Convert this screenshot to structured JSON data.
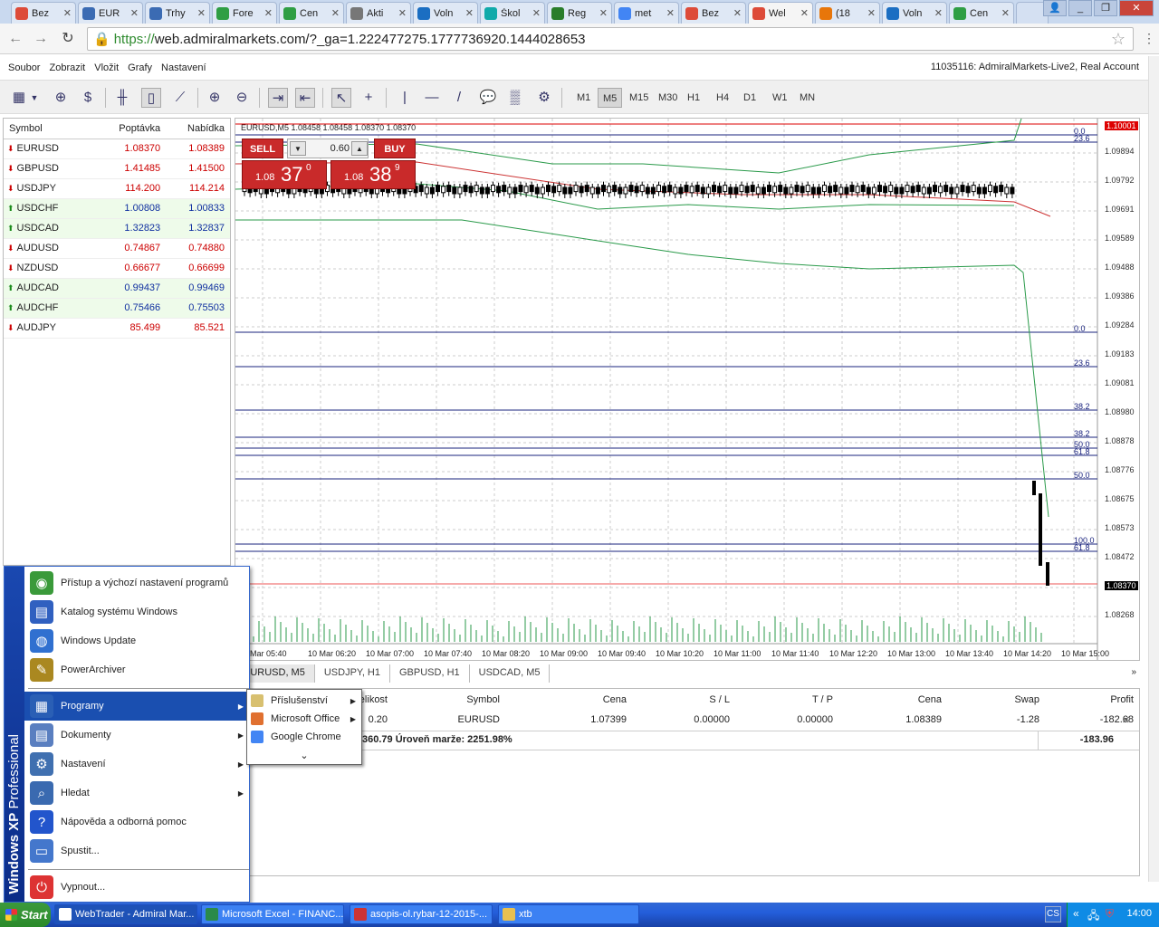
{
  "browser": {
    "tabs": [
      {
        "title": "Bez",
        "icon": "chrome-icon",
        "color": "#dd4b39"
      },
      {
        "title": "EUR",
        "icon": "fx-icon",
        "color": "#3b6bb3"
      },
      {
        "title": "Trhy",
        "icon": "fx-icon",
        "color": "#3b6bb3"
      },
      {
        "title": "Fore",
        "icon": "money-icon",
        "color": "#2f9e44"
      },
      {
        "title": "Cen",
        "icon": "chrome-icon",
        "color": "#2f9e44"
      },
      {
        "title": "Akti",
        "icon": "document-icon",
        "color": "#777777"
      },
      {
        "title": "Voln",
        "icon": "v-icon",
        "color": "#1b6ec2"
      },
      {
        "title": "Škol",
        "icon": "globe-icon",
        "color": "#1aa"
      },
      {
        "title": "Reg",
        "icon": "clover-icon",
        "color": "#2a7d2a"
      },
      {
        "title": "met",
        "icon": "google-icon",
        "color": "#4285f4"
      },
      {
        "title": "Bez",
        "icon": "chrome-icon",
        "color": "#dd4b39"
      },
      {
        "title": "Wel",
        "icon": "chrome-icon",
        "color": "#dd4b39",
        "active": true
      },
      {
        "title": "(18",
        "icon": "euro-icon",
        "color": "#e8760a"
      },
      {
        "title": "Voln",
        "icon": "v-icon",
        "color": "#1b6ec2"
      },
      {
        "title": "Cen",
        "icon": "chrome-icon",
        "color": "#2f9e44"
      }
    ],
    "url_scheme": "https://",
    "url_rest": "web.admiralmarkets.com/?_ga=1.222477275.1777736920.1444028653"
  },
  "app": {
    "menu": [
      "Soubor",
      "Zobrazit",
      "Vložit",
      "Grafy",
      "Nastavení"
    ],
    "account": "11035116: AdmiralMarkets-Live2, Real Account",
    "timeframes": [
      "M1",
      "M5",
      "M15",
      "M30",
      "H1",
      "H4",
      "D1",
      "W1",
      "MN"
    ],
    "active_timeframe": "M5"
  },
  "watchlist": {
    "headers": {
      "symbol": "Symbol",
      "bid": "Poptávka",
      "ask": "Nabídka"
    },
    "rows": [
      {
        "symbol": "EURUSD",
        "bid": "1.08370",
        "ask": "1.08389",
        "dir": "down"
      },
      {
        "symbol": "GBPUSD",
        "bid": "1.41485",
        "ask": "1.41500",
        "dir": "down"
      },
      {
        "symbol": "USDJPY",
        "bid": "114.200",
        "ask": "114.214",
        "dir": "down"
      },
      {
        "symbol": "USDCHF",
        "bid": "1.00808",
        "ask": "1.00833",
        "dir": "up"
      },
      {
        "symbol": "USDCAD",
        "bid": "1.32823",
        "ask": "1.32837",
        "dir": "up"
      },
      {
        "symbol": "AUDUSD",
        "bid": "0.74867",
        "ask": "0.74880",
        "dir": "down"
      },
      {
        "symbol": "NZDUSD",
        "bid": "0.66677",
        "ask": "0.66699",
        "dir": "down"
      },
      {
        "symbol": "AUDCAD",
        "bid": "0.99437",
        "ask": "0.99469",
        "dir": "up"
      },
      {
        "symbol": "AUDCHF",
        "bid": "0.75466",
        "ask": "0.75503",
        "dir": "up"
      },
      {
        "symbol": "AUDJPY",
        "bid": "85.499",
        "ask": "85.521",
        "dir": "down"
      }
    ]
  },
  "chart": {
    "header": "EURUSD,M5  1.08458 1.08458 1.08370 1.08370",
    "sell_label": "SELL",
    "buy_label": "BUY",
    "lot": "0.60",
    "sell_price": {
      "prefix": "1.08",
      "big": "37",
      "sup": "0"
    },
    "buy_price": {
      "prefix": "1.08",
      "big": "38",
      "sup": "9"
    },
    "price_ticks": [
      "1.09894",
      "1.09792",
      "1.09691",
      "1.09589",
      "1.09488",
      "1.09386",
      "1.09284",
      "1.09183",
      "1.09081",
      "1.08980",
      "1.08878",
      "1.08776",
      "1.08675",
      "1.08573",
      "1.08472",
      "1.08370",
      "1.08268"
    ],
    "top_price": "1.10001",
    "current_price": "1.08370",
    "fib_labels": [
      "0.0",
      "23.6",
      "0.0",
      "23.6",
      "38.2",
      "38.2",
      "50.0",
      "61.8",
      "50.0",
      "100.0",
      "61.8"
    ],
    "time_ticks": [
      "Mar 05:40",
      "10 Mar 06:20",
      "10 Mar 07:00",
      "10 Mar 07:40",
      "10 Mar 08:20",
      "10 Mar 09:00",
      "10 Mar 09:40",
      "10 Mar 10:20",
      "10 Mar 11:00",
      "10 Mar 11:40",
      "10 Mar 12:20",
      "10 Mar 13:00",
      "10 Mar 13:40",
      "10 Mar 14:20",
      "10 Mar 15:00"
    ],
    "tabs": [
      "EURUSD, M5",
      "USDJPY, H1",
      "GBPUSD, H1",
      "USDCAD, M5"
    ]
  },
  "terminal": {
    "headers": [
      "Velikost",
      "Symbol",
      "Cena",
      "S / L",
      "T / P",
      "Cena",
      "Swap",
      "Profit"
    ],
    "row": [
      "0.20",
      "EURUSD",
      "1.07399",
      "0.00000",
      "0.00000",
      "1.08389",
      "-1.28",
      "-182.68"
    ],
    "summary": "360.79  Úroveň marže: 2251.98%",
    "summary_profit": "-183.96"
  },
  "startmenu": {
    "band": "Windows XP",
    "band_edition": "Professional",
    "top_items": [
      "Přístup a výchozí nastavení programů",
      "Katalog systému Windows",
      "Windows Update",
      "PowerArchiver"
    ],
    "items": [
      "Programy",
      "Dokumenty",
      "Nastavení",
      "Hledat",
      "Nápověda a odborná pomoc",
      "Spustit..."
    ],
    "shutdown": "Vypnout...",
    "submenu": [
      "Příslušenství",
      "Microsoft Office",
      "Google Chrome"
    ]
  },
  "taskbar": {
    "start": "Start",
    "tasks": [
      "WebTrader - Admiral Mar...",
      "Microsoft Excel - FINANC...",
      "asopis-ol.rybar-12-2015-...",
      "xtb"
    ],
    "lang": "CS",
    "clock": "14:00"
  }
}
